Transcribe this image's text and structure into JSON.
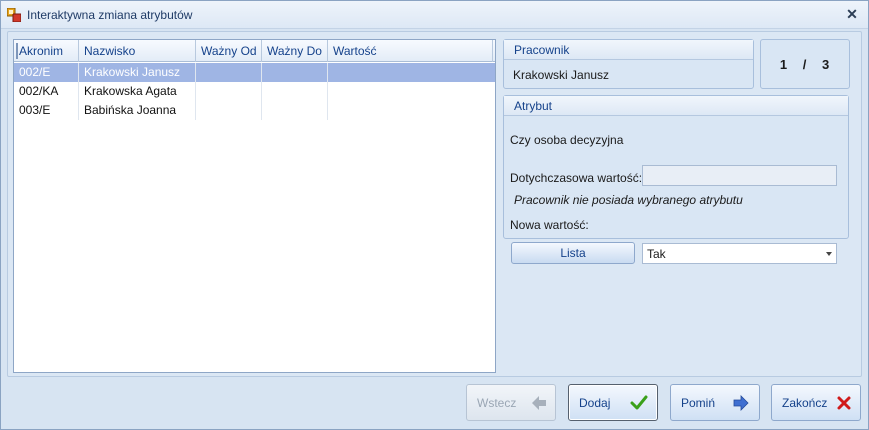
{
  "window": {
    "title": "Interaktywna zmiana atrybutów"
  },
  "grid": {
    "columns": [
      "Akronim",
      "Nazwisko",
      "Ważny Od",
      "Ważny Do",
      "Wartość"
    ],
    "rows": [
      {
        "akronim": "002/E",
        "nazwisko": "Krakowski Janusz",
        "wazny_od": "",
        "wazny_do": "",
        "wartosc": "",
        "selected": true
      },
      {
        "akronim": "002/KA",
        "nazwisko": "Krakowska Agata",
        "wazny_od": "",
        "wazny_do": "",
        "wartosc": "",
        "selected": false
      },
      {
        "akronim": "003/E",
        "nazwisko": "Babińska Joanna",
        "wazny_od": "",
        "wazny_do": "",
        "wartosc": "",
        "selected": false
      }
    ]
  },
  "pracownik": {
    "title": "Pracownik",
    "name": "Krakowski Janusz"
  },
  "counter": {
    "current": "1",
    "separator": "/",
    "total": "3"
  },
  "atrybut": {
    "title": "Atrybut",
    "name": "Czy osoba decyzyjna",
    "current_label": "Dotychczasowa wartość:",
    "current_value": "",
    "info": "Pracownik nie posiada wybranego atrybutu",
    "new_label": "Nowa wartość:"
  },
  "lista": {
    "label": "Lista"
  },
  "new_value": {
    "selected": "Tak"
  },
  "buttons": {
    "back": {
      "label": "Wstecz",
      "enabled": false
    },
    "add": {
      "label": "Dodaj"
    },
    "skip": {
      "label": "Pomiń"
    },
    "finish": {
      "label": "Zakończ"
    }
  },
  "colors": {
    "selection": "#9fb5e4",
    "accent": "#15428b",
    "check": "#3aa01a",
    "cross": "#d01a1a",
    "arrow": "#3f6fd1"
  }
}
